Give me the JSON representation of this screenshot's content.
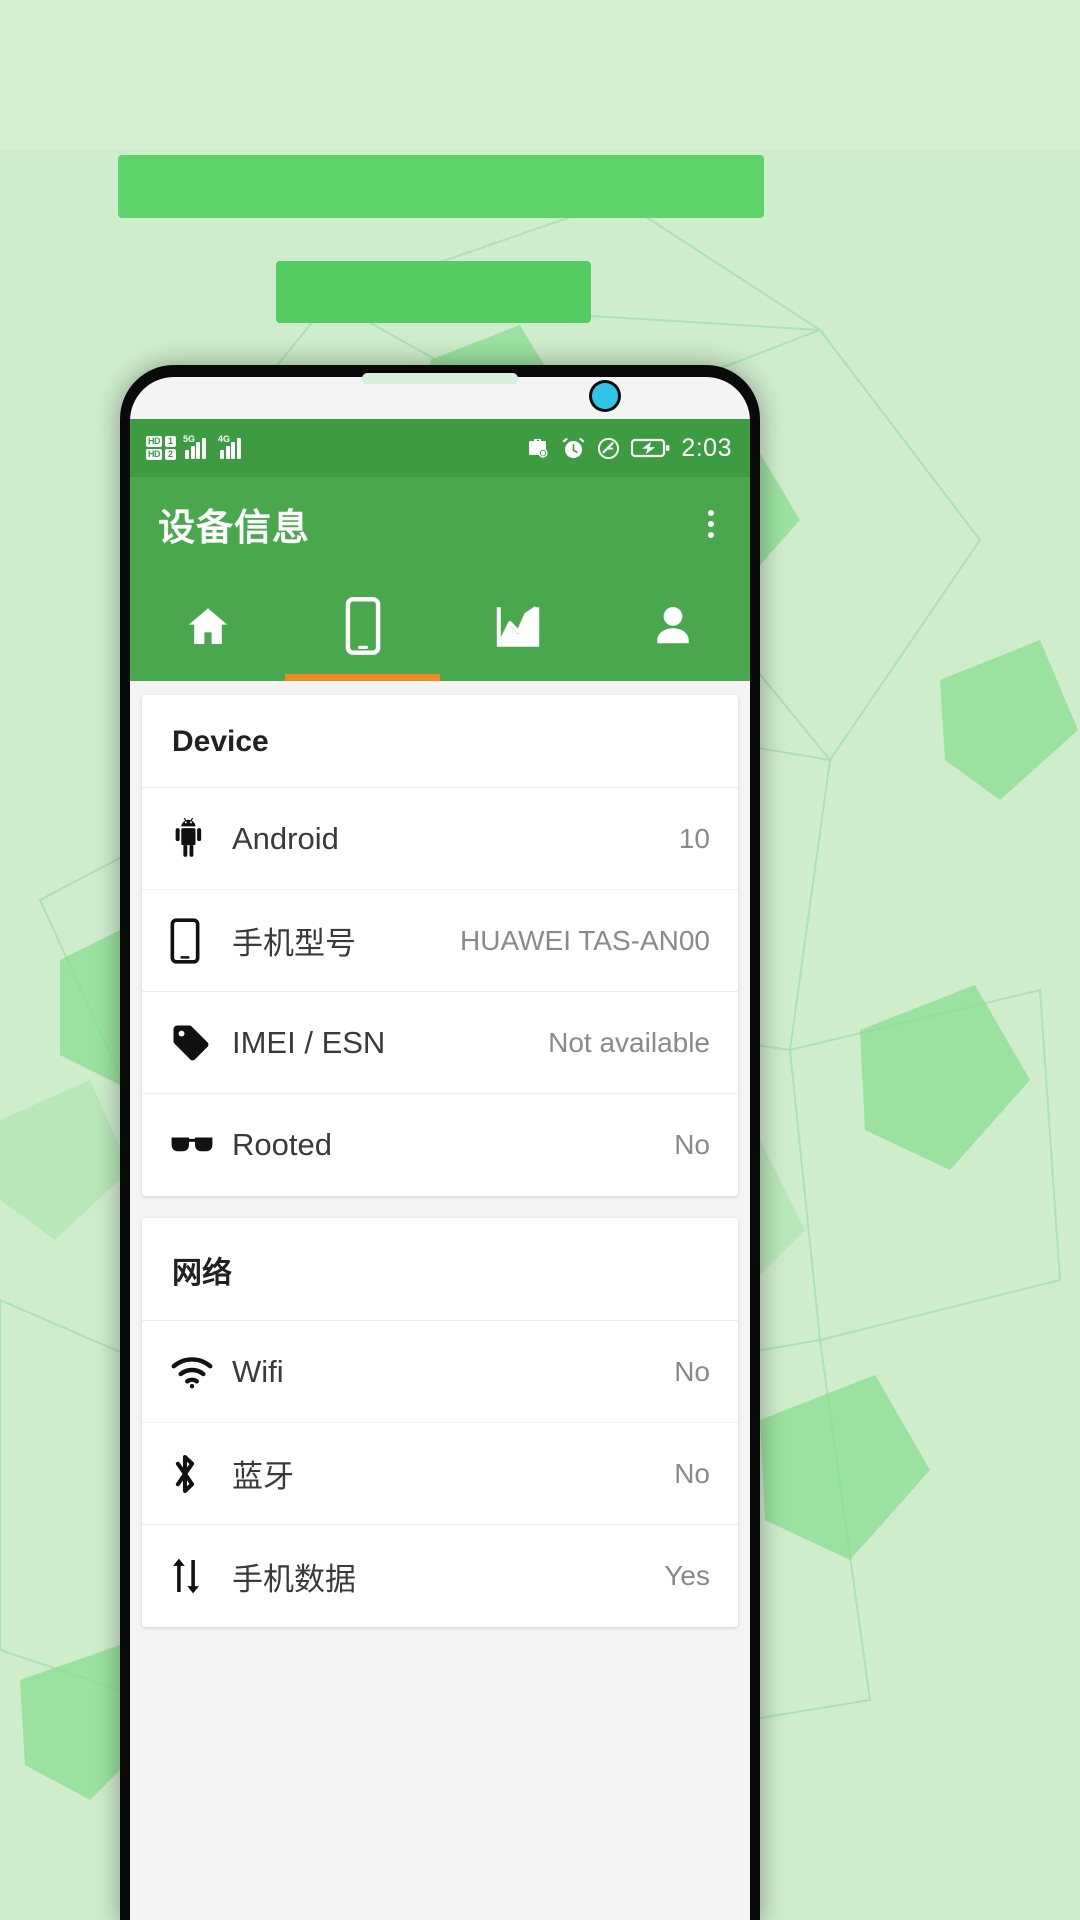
{
  "statusbar": {
    "hd_badge_1": "HD",
    "sim_badge_1": "1",
    "hd_badge_2": "HD",
    "sim_badge_2": "2",
    "signal_1_tag": "5G",
    "signal_2_tag": "4G",
    "clock": "2:03",
    "icons": [
      "briefcase-shield-icon",
      "alarm-clock-icon",
      "do-not-disturb-icon",
      "battery-charging-icon"
    ]
  },
  "appbar": {
    "title": "设备信息",
    "overflow_menu": "more-vertical-icon"
  },
  "tabs": [
    {
      "id": "home",
      "icon": "home-icon",
      "active": false
    },
    {
      "id": "device",
      "icon": "phone-icon",
      "active": true
    },
    {
      "id": "stats",
      "icon": "chart-icon",
      "active": false
    },
    {
      "id": "profile",
      "icon": "person-icon",
      "active": false
    }
  ],
  "cards": [
    {
      "title": "Device",
      "rows": [
        {
          "icon": "android-icon",
          "label": "Android",
          "value": "10"
        },
        {
          "icon": "phone-icon",
          "label": "手机型号",
          "value": "HUAWEI TAS-AN00"
        },
        {
          "icon": "tag-icon",
          "label": "IMEI / ESN",
          "value": "Not available"
        },
        {
          "icon": "sunglasses-icon",
          "label": "Rooted",
          "value": "No"
        }
      ]
    },
    {
      "title": "网络",
      "rows": [
        {
          "icon": "wifi-icon",
          "label": "Wifi",
          "value": "No"
        },
        {
          "icon": "bluetooth-icon",
          "label": "蓝牙",
          "value": "No"
        },
        {
          "icon": "data-arrows-icon",
          "label": "手机数据",
          "value": "Yes"
        }
      ]
    }
  ],
  "colors": {
    "appbar_green": "#49a84e",
    "statusbar_green": "#3d9c41",
    "tab_indicator_orange": "#f08a1e",
    "page_background": "#cfeccd",
    "promo_bar_green": "#5ed36a"
  }
}
